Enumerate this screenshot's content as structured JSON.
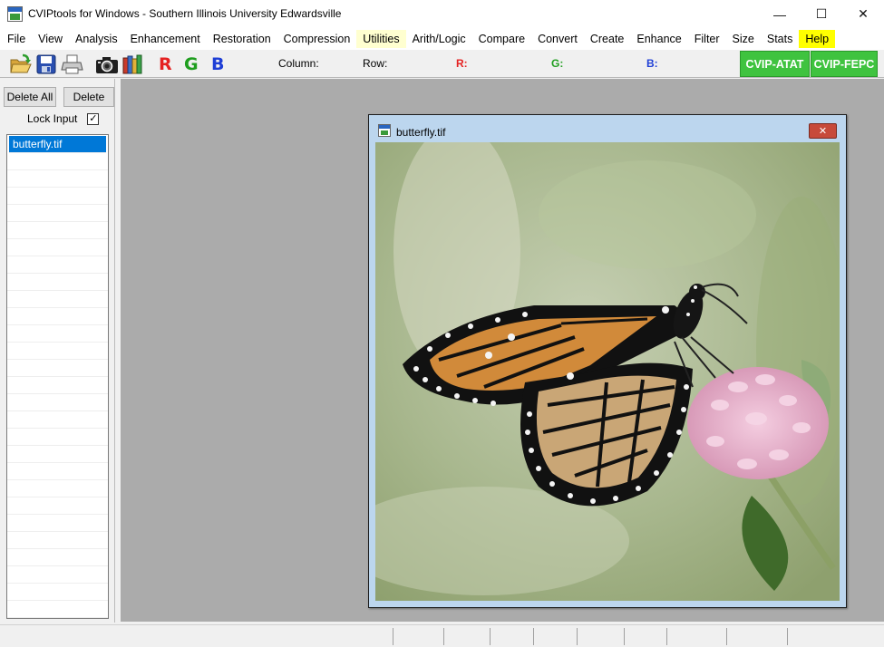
{
  "window": {
    "title": "CVIPtools for Windows - Southern Illinois University Edwardsville",
    "minimize_glyph": "—",
    "maximize_glyph": "☐",
    "close_glyph": "✕"
  },
  "menu": {
    "items": [
      "File",
      "View",
      "Analysis",
      "Enhancement",
      "Restoration",
      "Compression",
      "Utilities",
      "Arith/Logic",
      "Compare",
      "Convert",
      "Create",
      "Enhance",
      "Filter",
      "Size",
      "Stats",
      "Help"
    ]
  },
  "toolbar": {
    "icons": [
      "open-folder-icon",
      "save-disk-icon",
      "printer-icon",
      "camera-icon",
      "books-icon"
    ],
    "r_letter": "R",
    "g_letter": "G",
    "b_letter": "B",
    "column_label": "Column:",
    "row_label": "Row:",
    "r_label": "R:",
    "g_label": "G:",
    "b_label": "B:",
    "atat_button": "CVIP-ATAT",
    "fepc_button": "CVIP-FEPC",
    "colors": {
      "red": "#e52222",
      "green": "#1f9e1f",
      "blue": "#1f3fd6",
      "green_button": "#3fc33f"
    }
  },
  "sidebar": {
    "delete_all": "Delete All",
    "delete": "Delete",
    "lock_input_label": "Lock Input",
    "lock_input_checked": true,
    "checkmark": "✓",
    "files": [
      "butterfly.tif"
    ]
  },
  "image_window": {
    "title": "butterfly.tif",
    "close_glyph": "✕"
  },
  "colors": {
    "workspace": "#ababab",
    "selection": "#0078d7",
    "child_frame": "#bcd6ee"
  }
}
